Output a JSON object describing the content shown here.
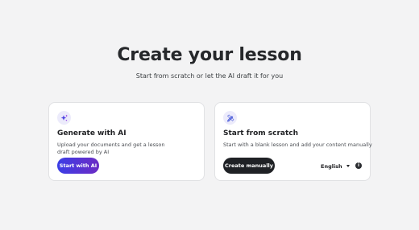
{
  "header": {
    "title": "Create your lesson",
    "subtitle": "Start from scratch or let the AI draft it for you"
  },
  "cards": {
    "ai": {
      "icon": "sparkles-icon",
      "title": "Generate with AI",
      "description": "Upload your documents and get a lesson draft powered by AI",
      "button_label": "Start with AI"
    },
    "manual": {
      "icon": "pencil-ruler-icon",
      "title": "Start from scratch",
      "description": "Start with a blank lesson and add your content manually",
      "button_label": "Create manually",
      "language": "English",
      "info_icon": "info-icon"
    }
  },
  "colors": {
    "background": "#f3f3f4",
    "ai_gradient_start": "#3a3ee6",
    "ai_gradient_end": "#6b2cc4",
    "dark_button": "#1f2125",
    "icon_bg": "#ecebfb",
    "accent": "#4a3fe0"
  }
}
